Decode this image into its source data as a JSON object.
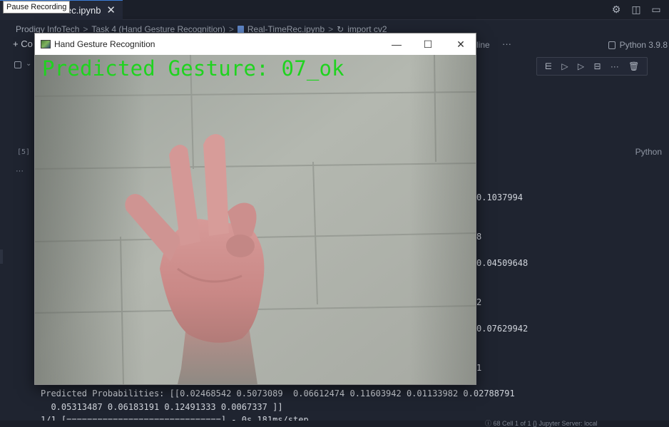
{
  "recording_badge": "Pause Recording",
  "tab": {
    "title": "ec.ipynb",
    "close": "✕"
  },
  "top_icons": {
    "settings": "⚙",
    "split": "◫",
    "layout": "▭"
  },
  "breadcrumb": {
    "items": [
      "Prodigy InfoTech",
      "Task 4 (Hand Gesture Recognition)",
      "Real-TimeRec.ipynb",
      "import cv2"
    ],
    "separator": ">"
  },
  "toolbar": {
    "plus_label": "+ Co",
    "outline_label": "line",
    "more": "···"
  },
  "kernel": {
    "label": "Python 3.9.8"
  },
  "cell": {
    "execution_count": "[5]",
    "language": "Python",
    "output_more": "···",
    "toolbar_icons": [
      "⋿",
      "▷",
      "▷",
      "⊟",
      "···",
      "🗑"
    ]
  },
  "right_output": [
    "0.1037994",
    "8",
    "0.04509648",
    "2",
    "0.07629942",
    "1"
  ],
  "output_lines": [
    "Predicted Probabilities: [[0.02468542 0.5073089  0.06612474 0.11603942 0.01133982 0.02788791",
    "  0.05313487 0.06183191 0.12491333 0.0067337 ]]",
    "1/1 [==============================] - 0s 181ms/step"
  ],
  "status": {
    "text": "ⓘ 68  Cell 1 of 1   {}   Jupyter Server: local"
  },
  "cv_window": {
    "title": "Hand Gesture Recognition",
    "minimize": "—",
    "maximize": "☐",
    "close": "✕",
    "overlay_text": "Predicted Gesture: 07_ok",
    "overlay_color": "#1fd31f"
  }
}
